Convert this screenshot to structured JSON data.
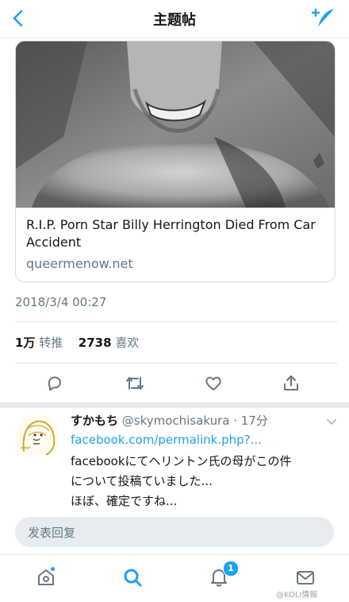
{
  "header": {
    "title": "主题帖"
  },
  "card": {
    "headline": "R.I.P. Porn Star Billy Herrington Died From Car Accident",
    "domain": "queermenow.net"
  },
  "tweet": {
    "timestamp": "2018/3/4 00:27",
    "retweet_count": "1万",
    "retweet_label": "转推",
    "like_count": "2738",
    "like_label": "喜欢"
  },
  "reply": {
    "display_name": "すかもち",
    "handle_time": "@skymochisakura · 17分",
    "link": "facebook.com/permalink.php?...",
    "lines": [
      "facebookにてヘリントン氏の母がこの件",
      "について投稿ていました...",
      "ほぼ、確定ですね..."
    ]
  },
  "reply_box": {
    "placeholder": "发表回复"
  },
  "nav": {
    "notification_count": "1"
  },
  "watermark": "@KOLI情報",
  "colors": {
    "accent": "#1da1f2",
    "muted": "#657786",
    "text": "#14171a"
  }
}
